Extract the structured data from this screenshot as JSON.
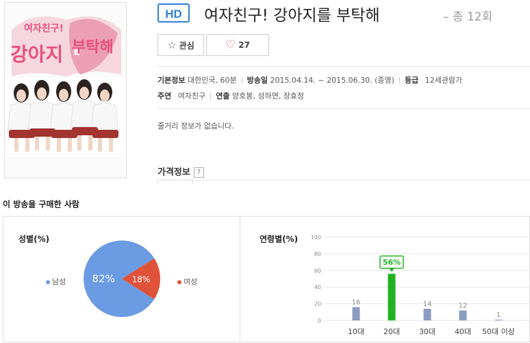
{
  "badge": "HD",
  "title": "여자친구! 강아지를 부탁해",
  "episodes": "– 총 12회",
  "buttons": {
    "favorite": "관심",
    "like_count": "27"
  },
  "info": {
    "basic_label": "기본정보",
    "basic_value": "대한민국, 60분",
    "air_label": "방송일",
    "air_value": "2015.04.14. ~ 2015.06.30. (종영)",
    "rating_label": "등급",
    "rating_value": "12세관람가",
    "cast_label": "주연",
    "cast_value": "여자친구",
    "director_label": "연출",
    "director_value": "양호봉, 성하연, 장효정"
  },
  "synopsis": "줄거리 정보가 없습니다.",
  "price_label": "가격정보",
  "help_icon": "?",
  "buyers_title": "이 방송을 구매한 사람",
  "poster_logo": {
    "line1": "여자친구!",
    "line2": "강아지",
    "line3": "를",
    "line4": "부탁해"
  },
  "colors": {
    "male": "#6b9be3",
    "female": "#e0523a",
    "age_bar": "#8b9cc0",
    "age_highlight": "#22b122",
    "hd": "#2f7fd8"
  },
  "chart_data": [
    {
      "type": "pie",
      "title": "성별(%)",
      "labels": [
        "남성",
        "여성"
      ],
      "values": [
        82,
        18
      ]
    },
    {
      "type": "bar",
      "title": "연령별(%)",
      "categories": [
        "10대",
        "20대",
        "30대",
        "40대",
        "50대 이상"
      ],
      "values": [
        16,
        56,
        14,
        12,
        1
      ],
      "ylim": [
        0,
        100
      ],
      "yticks": [
        0,
        20,
        40,
        60,
        80,
        100
      ],
      "highlight": "20대",
      "highlight_label": "56%"
    }
  ]
}
